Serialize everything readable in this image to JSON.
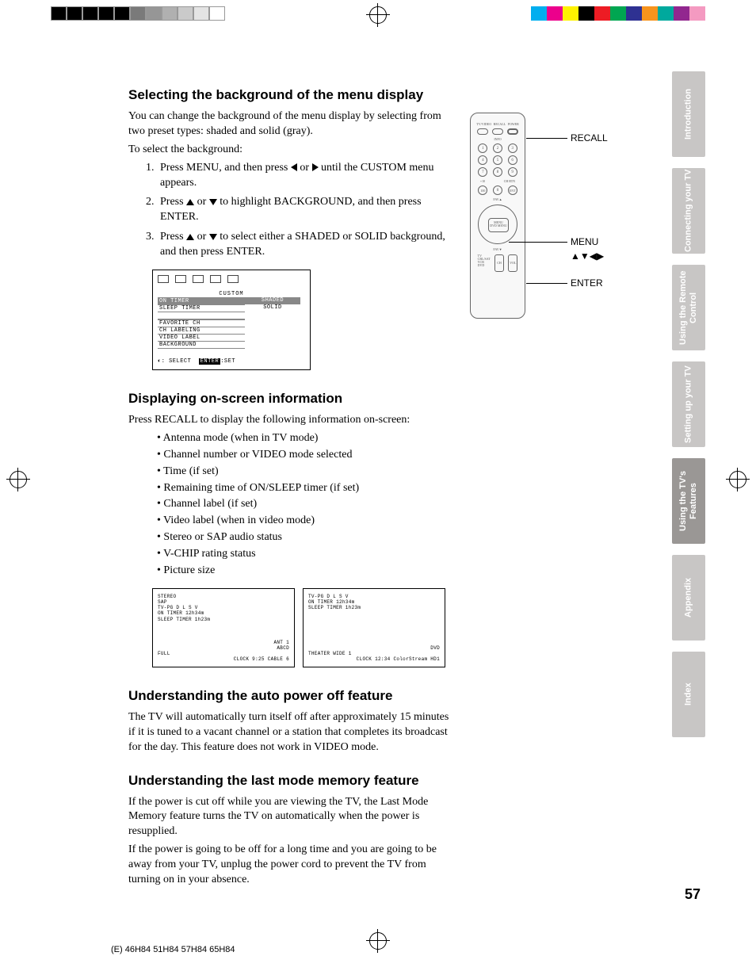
{
  "colorbar_left": [
    "#000",
    "#000",
    "#000",
    "#000",
    "#000",
    "#7a7a7a",
    "#969696",
    "#b0b0b0",
    "#cacaca",
    "#e4e4e4",
    "#fff"
  ],
  "colorbar_right": [
    "#00AEEF",
    "#EC008C",
    "#FFF200",
    "#000",
    "#ED1C24",
    "#00A651",
    "#2E3192",
    "#F7941D",
    "#00A99D",
    "#92278F",
    "#F49AC1"
  ],
  "sections": {
    "s1": {
      "heading": "Selecting the background of the menu display",
      "p1": "You can change the background of the menu display by selecting from two preset types: shaded and solid (gray).",
      "p2": "To select the background:",
      "steps": [
        "Press MENU, and then press ◀ or ▶ until the CUSTOM menu appears.",
        "Press ▲ or ▼ to highlight BACKGROUND, and then press ENTER.",
        "Press ▲ or ▼ to select either a SHADED or SOLID background, and then press ENTER."
      ]
    },
    "menu": {
      "title": "CUSTOM",
      "items": [
        "ON TIMER",
        "SLEEP TIMER",
        "FAVORITE CH",
        "CH LABELING",
        "VIDEO LABEL",
        "BACKGROUND"
      ],
      "right1": "SHADED",
      "right2": "SOLID",
      "bottom_select": ": SELECT",
      "bottom_enter": "ENTER",
      "bottom_set": ":SET"
    },
    "s2": {
      "heading": "Displaying on-screen information",
      "p1": "Press RECALL to display the following information on-screen:",
      "bullets": [
        "Antenna mode (when in TV mode)",
        "Channel number or VIDEO mode selected",
        "Time (if set)",
        "Remaining time of ON/SLEEP timer (if set)",
        "Channel label (if set)",
        "Video label (when in video mode)",
        "Stereo or SAP audio status",
        "V-CHIP rating status",
        "Picture size"
      ]
    },
    "osd1": {
      "l1": "STEREO",
      "l2": "SAP",
      "l3": "TV-PG D L S V",
      "l4": "ON TIMER   12h34m",
      "l5": "SLEEP TIMER 1h23m",
      "b1": "ANT 1",
      "b2": "ABCD",
      "b3": "FULL",
      "b4": "CLOCK  9:25   CABLE    6"
    },
    "osd2": {
      "l1": "TV-PG D L S V",
      "l2": "ON TIMER   12h34m",
      "l3": "SLEEP TIMER 1h23m",
      "b1": "DVD",
      "b2": "THEATER WIDE 1",
      "b3": "CLOCK 12:34   ColorStream HD1"
    },
    "s3": {
      "heading": "Understanding the auto power off feature",
      "p1": "The TV will automatically turn itself off after approximately 15 minutes if it is tuned to a vacant channel or a station that completes its broadcast for the day. This feature does not work in VIDEO mode."
    },
    "s4": {
      "heading": "Understanding the last mode memory feature",
      "p1": "If the power is cut off while you are viewing the TV, the Last Mode Memory feature turns the TV on automatically when the power is resupplied.",
      "p2": "If the power is going to be off for a long time and you are going to be away from your TV, unplug the power cord to prevent the TV from turning on in your absence."
    }
  },
  "remote": {
    "top_labels": [
      "TV/VIDEO",
      "RECALL",
      "POWER"
    ],
    "info": "INFO",
    "nums": [
      "1",
      "2",
      "3",
      "4",
      "5",
      "6",
      "7",
      "8",
      "9",
      "100",
      "0",
      "ENT"
    ],
    "row4_labels": [
      "+10",
      "",
      "CH RTN"
    ],
    "fav_up": "FAV▲",
    "dpad_center1": "MENU",
    "dpad_center2": "DVD MENU",
    "fav_dn": "FAV▼",
    "side_labels": [
      "TV",
      "CBL/SAT",
      "VCR",
      "DVD"
    ],
    "ch": "CH",
    "vol": "VOL"
  },
  "callouts": {
    "recall": "RECALL",
    "menu": "MENU",
    "arrows": "▲▼◀▶",
    "enter": "ENTER"
  },
  "tabs": [
    "Introduction",
    "Connecting your TV",
    "Using the Remote Control",
    "Setting up your TV",
    "Using the TV's Features",
    "Appendix",
    "Index"
  ],
  "active_tab_index": 4,
  "page_number": "57",
  "footer": "(E) 46H84 51H84 57H84 65H84"
}
